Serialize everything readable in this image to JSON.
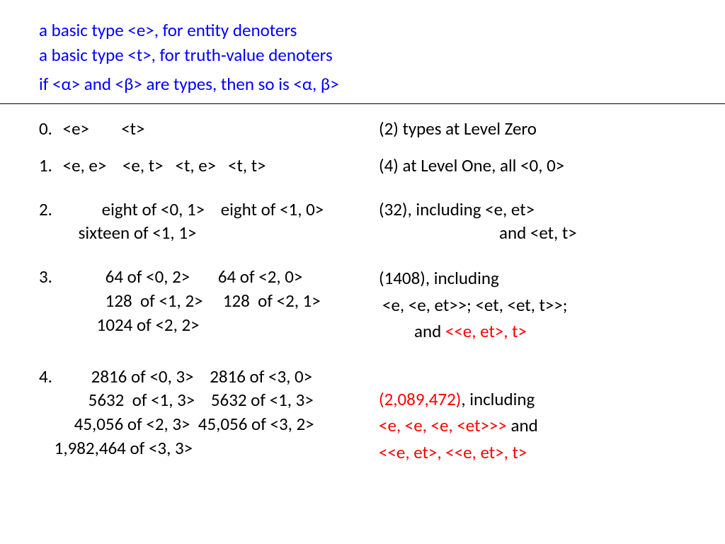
{
  "header": {
    "line1": "a basic type <e>, for entity denoters",
    "line2": "a basic type <t>, for truth-value denoters",
    "line3": "if <α> and <β> are types, then so is <α, β>"
  },
  "rows": {
    "r0": {
      "num": "0.",
      "left": "<e>        <t>",
      "right": "(2) types at Level Zero"
    },
    "r1": {
      "num": "1.",
      "left": "<e, e>    <e, t>   <t, e>   <t, t>",
      "right": "(4) at Level One, all <0, 0>"
    },
    "r2": {
      "num": "2.",
      "left_l1": "eight of <0, 1>    eight of <1, 0>",
      "left_l2": "sixteen of <1, 1>",
      "right_l1": "(32), including <e, et>",
      "right_l2": "and <et, t>"
    },
    "r3": {
      "num": "3.",
      "left_l1": "64 of <0, 2>       64 of <2, 0>",
      "left_l2": "128  of <1, 2>     128  of <2, 1>",
      "left_l3": "1024 of <2, 2>",
      "right_l1": "(1408), including",
      "right_l2": "<e, <e, et>>; <et, <et, t>>;",
      "right_l3_a": "and ",
      "right_l3_b": "<<e, et>, t>"
    },
    "r4": {
      "num": "4.",
      "left_l1": "2816 of <0, 3>    2816 of <3, 0>",
      "left_l2": "5632  of <1, 3>    5632 of <1, 3>",
      "left_l3": "45,056 of <2, 3>  45,056 of <3, 2>",
      "left_l4": "1,982,464 of <3, 3>",
      "right_l1_a": "(2,089,472)",
      "right_l1_b": ", including",
      "right_l2_a": "<e, <e, <e, <et>>>",
      "right_l2_b": " and",
      "right_l3": "<<e, et>, <<e, et>, t>"
    }
  }
}
